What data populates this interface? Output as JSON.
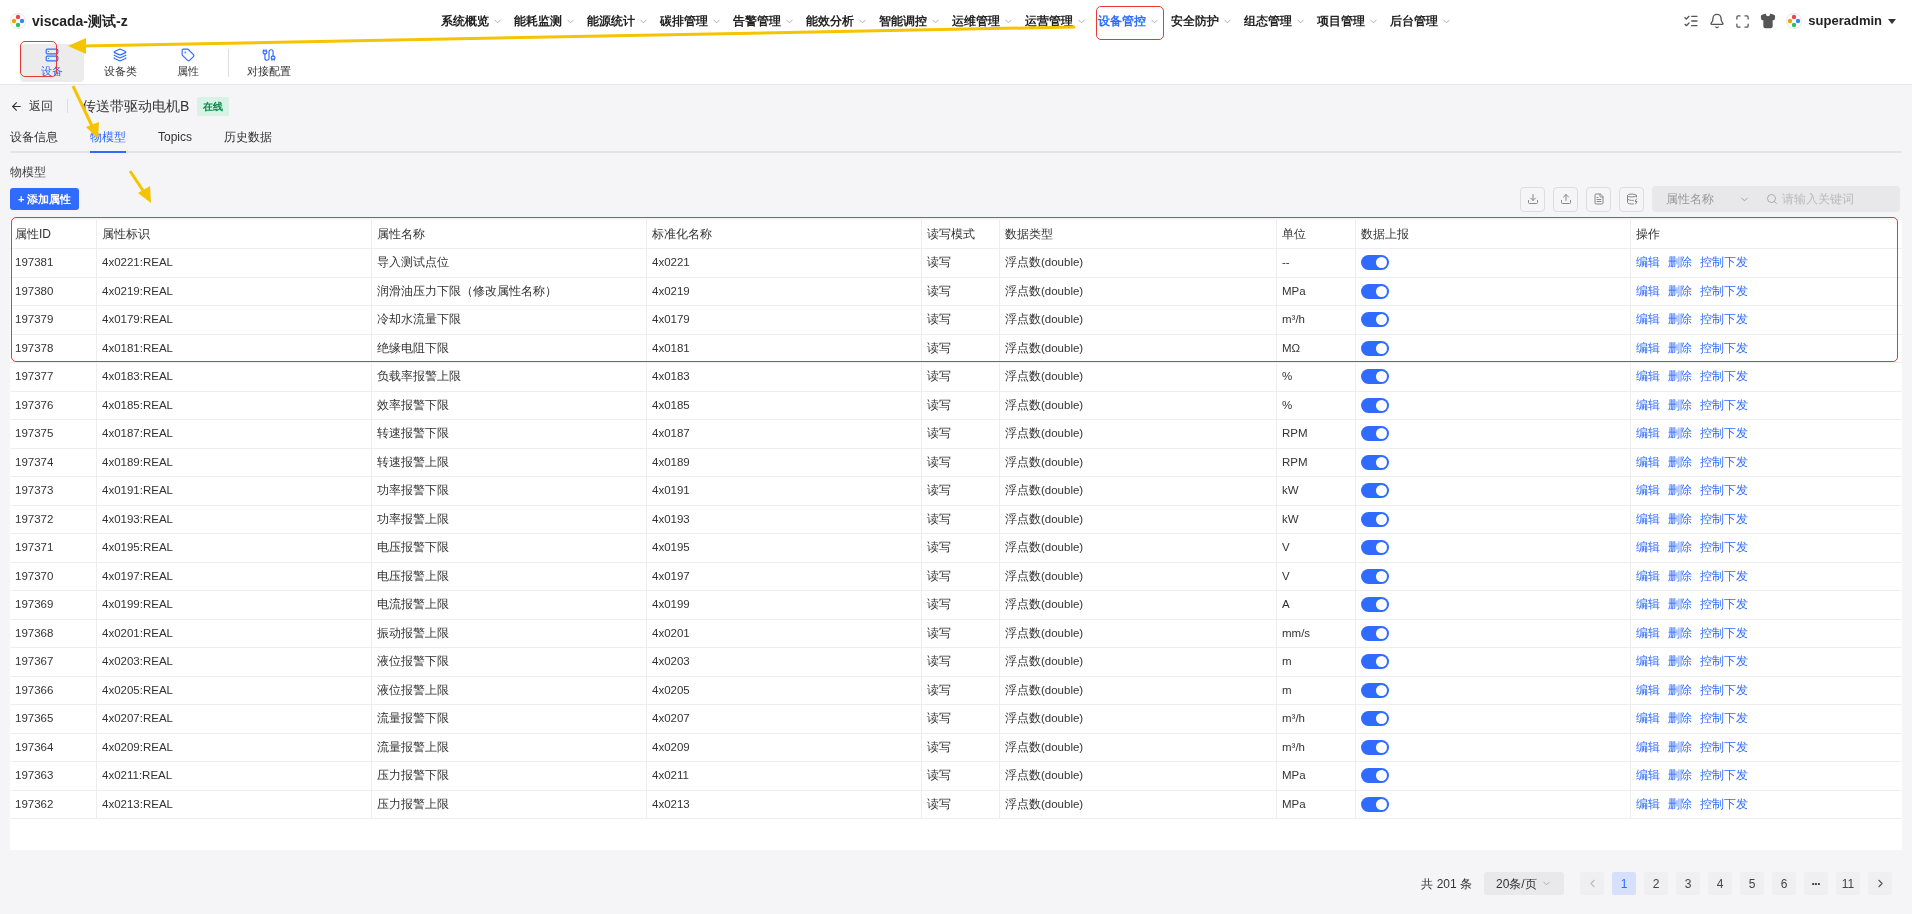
{
  "app": {
    "title": "viscada-测试-z"
  },
  "nav": {
    "items": [
      {
        "label": "系统概览",
        "selected": false
      },
      {
        "label": "能耗监测",
        "selected": false
      },
      {
        "label": "能源统计",
        "selected": false
      },
      {
        "label": "碳排管理",
        "selected": false
      },
      {
        "label": "告警管理",
        "selected": false
      },
      {
        "label": "能效分析",
        "selected": false
      },
      {
        "label": "智能调控",
        "selected": false
      },
      {
        "label": "运维管理",
        "selected": false
      },
      {
        "label": "运营管理",
        "selected": false
      },
      {
        "label": "设备管控",
        "selected": true
      },
      {
        "label": "安全防护",
        "selected": false
      },
      {
        "label": "组态管理",
        "selected": false
      },
      {
        "label": "项目管理",
        "selected": false
      },
      {
        "label": "后台管理",
        "selected": false
      }
    ]
  },
  "user": {
    "name": "superadmin"
  },
  "subnav": {
    "items": [
      {
        "label": "设备",
        "selected": true
      },
      {
        "label": "设备类",
        "selected": false
      },
      {
        "label": "属性",
        "selected": false
      },
      {
        "label": "对接配置",
        "selected": false
      }
    ]
  },
  "back": "返回",
  "device": {
    "name": "传送带驱动电机B",
    "status": "在线"
  },
  "tabs": [
    {
      "label": "设备信息",
      "selected": false
    },
    {
      "label": "物模型",
      "selected": true
    },
    {
      "label": "Topics",
      "selected": false
    },
    {
      "label": "历史数据",
      "selected": false
    }
  ],
  "section_title": "物模型",
  "add_button": "+ 添加属性",
  "filter": {
    "field": "属性名称",
    "placeholder": "请输入关键词"
  },
  "table": {
    "columns": [
      "属性ID",
      "属性标识",
      "属性名称",
      "标准化名称",
      "读写模式",
      "数据类型",
      "单位",
      "数据上报",
      "操作"
    ],
    "rows": [
      {
        "cells": [
          "197381",
          "4x0221:REAL",
          "导入测试点位",
          "4x0221",
          "读写",
          "浮点数(double)",
          "--"
        ],
        "report_on": true,
        "actions": [
          "编辑",
          "删除",
          "控制下发"
        ]
      },
      {
        "cells": [
          "197380",
          "4x0219:REAL",
          "润滑油压力下限（修改属性名称）",
          "4x0219",
          "读写",
          "浮点数(double)",
          "MPa"
        ],
        "report_on": true,
        "actions": [
          "编辑",
          "删除",
          "控制下发"
        ]
      },
      {
        "cells": [
          "197379",
          "4x0179:REAL",
          "冷却水流量下限",
          "4x0179",
          "读写",
          "浮点数(double)",
          "m³/h"
        ],
        "report_on": true,
        "actions": [
          "编辑",
          "删除",
          "控制下发"
        ]
      },
      {
        "cells": [
          "197378",
          "4x0181:REAL",
          "绝缘电阻下限",
          "4x0181",
          "读写",
          "浮点数(double)",
          "MΩ"
        ],
        "report_on": true,
        "actions": [
          "编辑",
          "删除",
          "控制下发"
        ]
      },
      {
        "cells": [
          "197377",
          "4x0183:REAL",
          "负载率报警上限",
          "4x0183",
          "读写",
          "浮点数(double)",
          "%"
        ],
        "report_on": true,
        "actions": [
          "编辑",
          "删除",
          "控制下发"
        ]
      },
      {
        "cells": [
          "197376",
          "4x0185:REAL",
          "效率报警下限",
          "4x0185",
          "读写",
          "浮点数(double)",
          "%"
        ],
        "report_on": true,
        "actions": [
          "编辑",
          "删除",
          "控制下发"
        ]
      },
      {
        "cells": [
          "197375",
          "4x0187:REAL",
          "转速报警下限",
          "4x0187",
          "读写",
          "浮点数(double)",
          "RPM"
        ],
        "report_on": true,
        "actions": [
          "编辑",
          "删除",
          "控制下发"
        ]
      },
      {
        "cells": [
          "197374",
          "4x0189:REAL",
          "转速报警上限",
          "4x0189",
          "读写",
          "浮点数(double)",
          "RPM"
        ],
        "report_on": true,
        "actions": [
          "编辑",
          "删除",
          "控制下发"
        ]
      },
      {
        "cells": [
          "197373",
          "4x0191:REAL",
          "功率报警下限",
          "4x0191",
          "读写",
          "浮点数(double)",
          "kW"
        ],
        "report_on": true,
        "actions": [
          "编辑",
          "删除",
          "控制下发"
        ]
      },
      {
        "cells": [
          "197372",
          "4x0193:REAL",
          "功率报警上限",
          "4x0193",
          "读写",
          "浮点数(double)",
          "kW"
        ],
        "report_on": true,
        "actions": [
          "编辑",
          "删除",
          "控制下发"
        ]
      },
      {
        "cells": [
          "197371",
          "4x0195:REAL",
          "电压报警下限",
          "4x0195",
          "读写",
          "浮点数(double)",
          "V"
        ],
        "report_on": true,
        "actions": [
          "编辑",
          "删除",
          "控制下发"
        ]
      },
      {
        "cells": [
          "197370",
          "4x0197:REAL",
          "电压报警上限",
          "4x0197",
          "读写",
          "浮点数(double)",
          "V"
        ],
        "report_on": true,
        "actions": [
          "编辑",
          "删除",
          "控制下发"
        ]
      },
      {
        "cells": [
          "197369",
          "4x0199:REAL",
          "电流报警上限",
          "4x0199",
          "读写",
          "浮点数(double)",
          "A"
        ],
        "report_on": true,
        "actions": [
          "编辑",
          "删除",
          "控制下发"
        ]
      },
      {
        "cells": [
          "197368",
          "4x0201:REAL",
          "振动报警上限",
          "4x0201",
          "读写",
          "浮点数(double)",
          "mm/s"
        ],
        "report_on": true,
        "actions": [
          "编辑",
          "删除",
          "控制下发"
        ]
      },
      {
        "cells": [
          "197367",
          "4x0203:REAL",
          "液位报警下限",
          "4x0203",
          "读写",
          "浮点数(double)",
          "m"
        ],
        "report_on": true,
        "actions": [
          "编辑",
          "删除",
          "控制下发"
        ]
      },
      {
        "cells": [
          "197366",
          "4x0205:REAL",
          "液位报警上限",
          "4x0205",
          "读写",
          "浮点数(double)",
          "m"
        ],
        "report_on": true,
        "actions": [
          "编辑",
          "删除",
          "控制下发"
        ]
      },
      {
        "cells": [
          "197365",
          "4x0207:REAL",
          "流量报警下限",
          "4x0207",
          "读写",
          "浮点数(double)",
          "m³/h"
        ],
        "report_on": true,
        "actions": [
          "编辑",
          "删除",
          "控制下发"
        ]
      },
      {
        "cells": [
          "197364",
          "4x0209:REAL",
          "流量报警上限",
          "4x0209",
          "读写",
          "浮点数(double)",
          "m³/h"
        ],
        "report_on": true,
        "actions": [
          "编辑",
          "删除",
          "控制下发"
        ]
      },
      {
        "cells": [
          "197363",
          "4x0211:REAL",
          "压力报警下限",
          "4x0211",
          "读写",
          "浮点数(double)",
          "MPa"
        ],
        "report_on": true,
        "actions": [
          "编辑",
          "删除",
          "控制下发"
        ]
      },
      {
        "cells": [
          "197362",
          "4x0213:REAL",
          "压力报警上限",
          "4x0213",
          "读写",
          "浮点数(double)",
          "MPa"
        ],
        "report_on": true,
        "actions": [
          "编辑",
          "删除",
          "控制下发"
        ]
      }
    ]
  },
  "pagination": {
    "total": "共 201 条",
    "page_size": "20条/页",
    "ellipsis": "•••",
    "pages": [
      {
        "label": "1",
        "selected": true
      },
      {
        "label": "2",
        "selected": false
      },
      {
        "label": "3",
        "selected": false
      },
      {
        "label": "4",
        "selected": false
      },
      {
        "label": "5",
        "selected": false
      },
      {
        "label": "6",
        "selected": false
      },
      {
        "label": "11",
        "selected": false
      }
    ]
  }
}
